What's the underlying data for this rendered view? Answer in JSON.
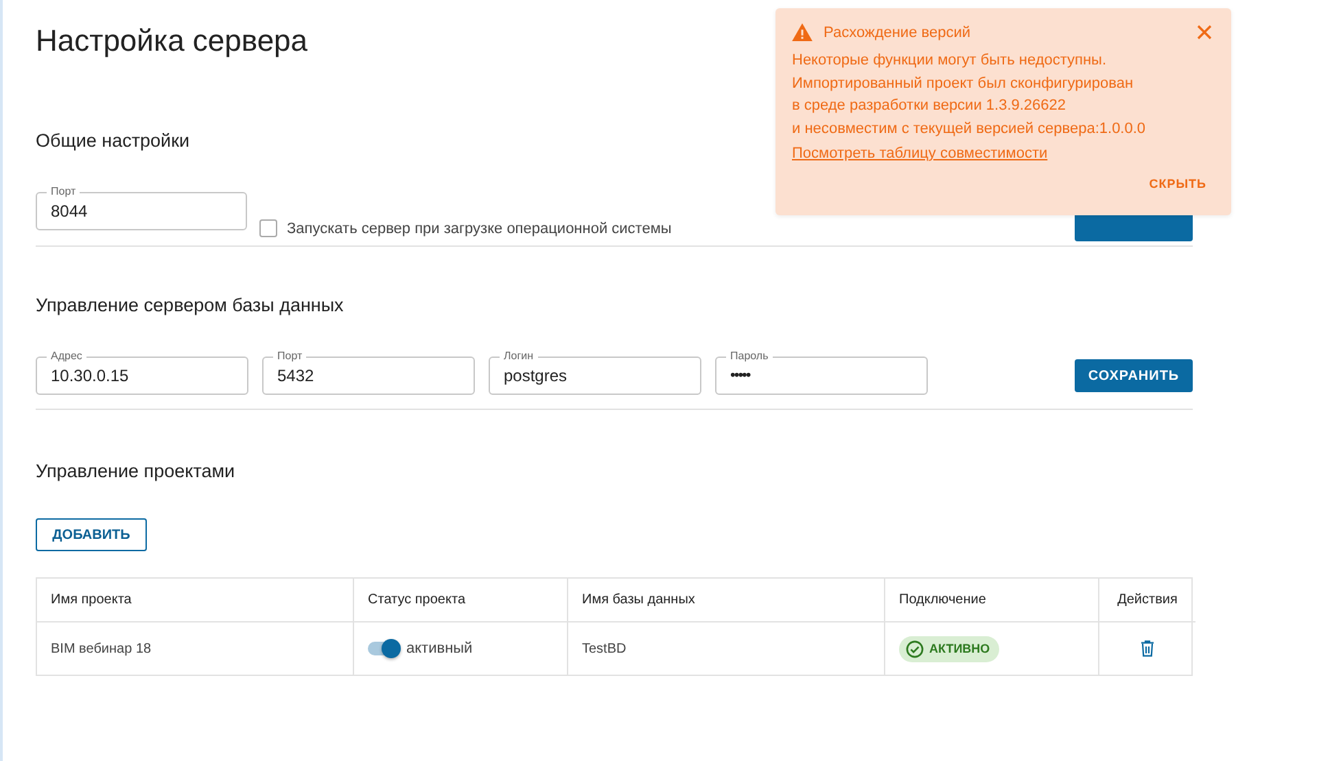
{
  "title": "Настройка сервера",
  "general": {
    "heading": "Общие настройки",
    "port": {
      "label": "Порт",
      "value": "8044"
    },
    "autostart": {
      "label": "Запускать сервер при загрузке операционной системы",
      "checked": false
    }
  },
  "database": {
    "heading": "Управление сервером базы данных",
    "fields": [
      {
        "label": "Адрес",
        "value": "10.30.0.15",
        "kind": "text"
      },
      {
        "label": "Порт",
        "value": "5432",
        "kind": "text"
      },
      {
        "label": "Логин",
        "value": "postgres",
        "kind": "text"
      },
      {
        "label": "Пароль",
        "value": "•••••",
        "kind": "password"
      }
    ],
    "save_button": "СОХРАНИТЬ"
  },
  "projects": {
    "heading": "Управление проектами",
    "add_button": "ДОБАВИТЬ",
    "columns": [
      "Имя проекта",
      "Статус проекта",
      "Имя базы данных",
      "Подключение",
      "Действия"
    ],
    "rows": [
      {
        "name": "BIM вебинар 18",
        "status": {
          "on": true,
          "label": "активный"
        },
        "database": "TestBD",
        "connection": "АКТИВНО"
      }
    ]
  },
  "toast": {
    "title": "Расхождение версий",
    "lines": [
      "Некоторые функции могут быть недоступны.",
      "Импортированный проект был сконфигурирован",
      "в среде разработки версии 1.3.9.26622",
      "и несовместим с текущей версией сервера:1.0.0.0"
    ],
    "link": "Посмотреть таблицу совместимости",
    "action": "СКРЫТЬ"
  }
}
